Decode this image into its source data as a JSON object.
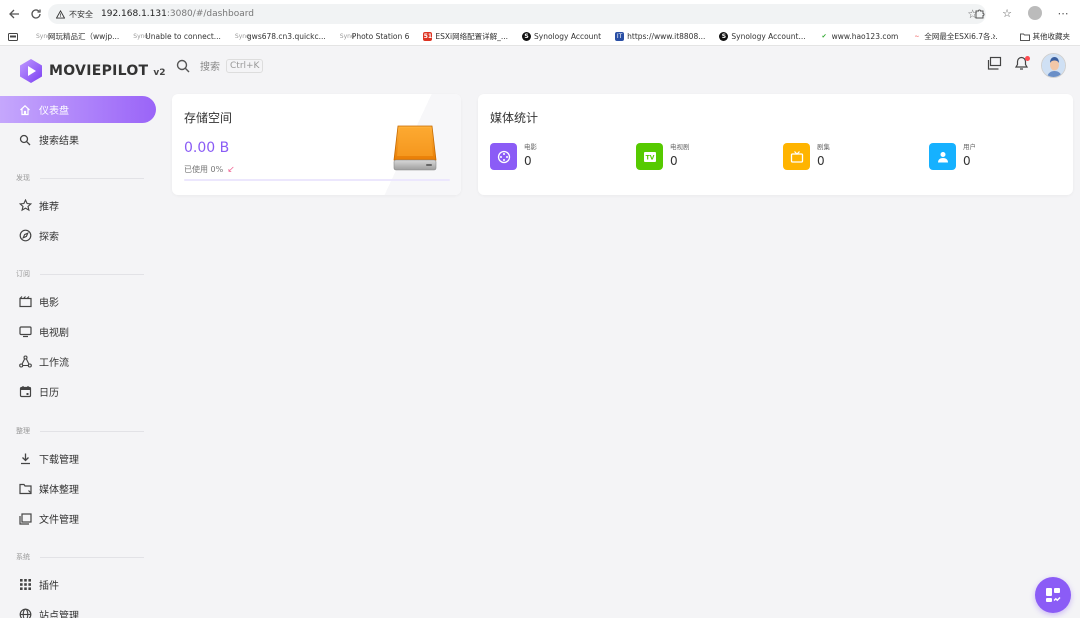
{
  "browser": {
    "security_warning": "不安全",
    "url_host": "192.168.1.131",
    "url_path": ":3080/#/dashboard"
  },
  "bookmarks": [
    {
      "label": "网玩精品汇（wwjp...",
      "icon": "synology-icon",
      "fav_text": "Syno"
    },
    {
      "label": "Unable to connect...",
      "icon": "synology-icon",
      "fav_text": "Syno"
    },
    {
      "label": "gws678.cn3.quickc...",
      "icon": "synology-icon",
      "fav_text": "Syno"
    },
    {
      "label": "Photo Station 6",
      "icon": "synology-icon",
      "fav_text": "Syno"
    },
    {
      "label": "ESXi网络配置详解_...",
      "icon": "51cto-icon",
      "fav_text": "51"
    },
    {
      "label": "Synology Account",
      "icon": "s-logo-icon",
      "fav_text": "S"
    },
    {
      "label": "https://www.it8808...",
      "icon": "it-icon",
      "fav_text": "IT"
    },
    {
      "label": "Synology Account...",
      "icon": "s-logo-icon",
      "fav_text": "S"
    },
    {
      "label": "www.hao123.com",
      "icon": "hao123-icon",
      "fav_text": "✔"
    },
    {
      "label": "全网最全ESXi6.7各...",
      "icon": "csdn-icon",
      "fav_text": "∼"
    }
  ],
  "bookmarks_folder": "其他收藏夹",
  "app": {
    "logo_text": "MOVIEPILOT",
    "logo_version": "v2",
    "search_placeholder": "搜索",
    "search_shortcut": "Ctrl+K"
  },
  "sidebar": {
    "items_top": [
      {
        "label": "仪表盘",
        "icon": "home-icon",
        "active": true
      },
      {
        "label": "搜索结果",
        "icon": "search-icon"
      }
    ],
    "sections": [
      {
        "title": "发现",
        "items": [
          {
            "label": "推荐",
            "icon": "star-icon"
          },
          {
            "label": "探索",
            "icon": "compass-icon"
          }
        ]
      },
      {
        "title": "订阅",
        "items": [
          {
            "label": "电影",
            "icon": "movie-icon"
          },
          {
            "label": "电视剧",
            "icon": "tv-icon"
          },
          {
            "label": "工作流",
            "icon": "workflow-icon"
          },
          {
            "label": "日历",
            "icon": "calendar-icon"
          }
        ]
      },
      {
        "title": "整理",
        "items": [
          {
            "label": "下载管理",
            "icon": "download-icon"
          },
          {
            "label": "媒体整理",
            "icon": "folder-icon"
          },
          {
            "label": "文件管理",
            "icon": "files-icon"
          }
        ]
      },
      {
        "title": "系统",
        "items": [
          {
            "label": "插件",
            "icon": "grid-icon"
          },
          {
            "label": "站点管理",
            "icon": "globe-icon"
          }
        ]
      }
    ]
  },
  "storage": {
    "title": "存储空间",
    "value": "0.00 B",
    "used_label": "已使用 0%",
    "used_fraction": 0.0
  },
  "media_stats": {
    "title": "媒体统计",
    "items": [
      {
        "label": "电影",
        "value": "0",
        "color": "#8b5cf6",
        "icon": "film-reel-icon"
      },
      {
        "label": "电视剧",
        "value": "0",
        "color": "#56ca00",
        "icon": "tv-badge-icon"
      },
      {
        "label": "剧集",
        "value": "0",
        "color": "#ffb400",
        "icon": "episode-icon"
      },
      {
        "label": "用户",
        "value": "0",
        "color": "#16b1ff",
        "icon": "user-icon"
      }
    ]
  },
  "colors": {
    "accent": "#8b5cf6"
  }
}
